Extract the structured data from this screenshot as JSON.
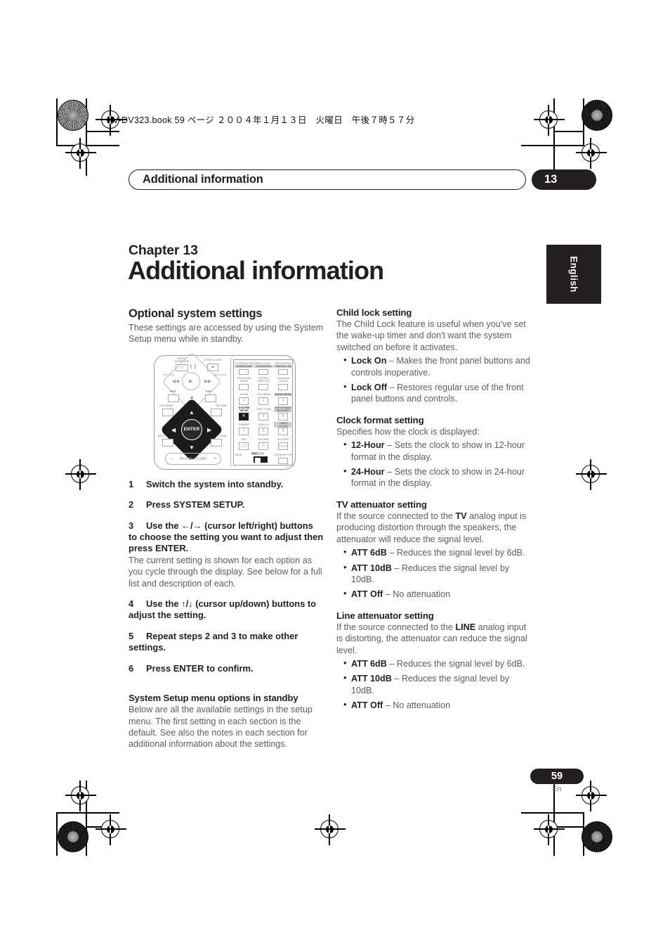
{
  "slug": {
    "text": "XV-DV323.book  59 ページ  ２００４年１月１３日　火曜日　午後７時５７分"
  },
  "running_header": {
    "title": "Additional information",
    "chapter_number": "13"
  },
  "chapter": {
    "label": "Chapter 13",
    "title": "Additional information",
    "language_tab": "English"
  },
  "left_column": {
    "section_title": "Optional system settings",
    "intro": "These settings are accessed by using the System Setup menu while in standby.",
    "remote": {
      "labels": {
        "surround_top": "FRONT",
        "surround": "SURROUND",
        "open_close": "OPEN CLOSE",
        "prev_next_left": "◄◄/◄◄)",
        "prev_next_right": "))►►/►►",
        "dvd_menu": "DVD MENU",
        "return": "RETURN",
        "mute": "MUTE",
        "sound": "SOUND",
        "enter": "ENTER",
        "master_volume": "MASTER VOLUME",
        "minus": "–",
        "plus": "+",
        "col1_top": "LISTENING MODE",
        "col1_top2": "SURROUND",
        "col2_top": "DIALOGUE",
        "col2_top2": "ADVANCED",
        "col3_top": "EXT/STEREO",
        "col3_top2": "VIRTUAL SB",
        "program": "PROGRAM",
        "audio": "AUDIO",
        "repeat": "REPEAT",
        "subtitle": "SUBTITLE",
        "random": "RANDOM",
        "angle": "ANGLE",
        "zoom": "ZOOM",
        "top_menu": "TOP MENU",
        "home_menu": "HOME MENU",
        "system_setup": "SYSTEM SETUP",
        "test_tone": "TEST TONE",
        "setup_navi": "SETUP NAVI/MIDNIGHT",
        "dimmer": "DIMMER",
        "display": "DISPLAY",
        "timer_clock": "TIMER/CLOCK",
        "sr_plus": "SR+",
        "folder_minus": "FOLDER-",
        "folder_plus": "FOLDER+",
        "clr": "CLR",
        "enter_key": "ENTER",
        "main": "MAIN",
        "sub": "SUB",
        "room_setup": "ROOM SETUP",
        "num1": "1",
        "num2": "2",
        "num3": "3",
        "num4": "4",
        "num5": "5",
        "num6": "6",
        "num7": "7",
        "num8": "8",
        "num9": "9",
        "num0": "0"
      }
    },
    "steps": [
      {
        "num": "1",
        "text": "Switch the system into standby.",
        "note": ""
      },
      {
        "num": "2",
        "text": "Press SYSTEM SETUP.",
        "note": ""
      },
      {
        "num": "3",
        "text": "Use the ←/→ (cursor left/right) buttons to choose the setting you want to adjust then press ENTER.",
        "note": "The current setting is shown for each option as you cycle through the display. See below for a full list and description of each."
      },
      {
        "num": "4",
        "text": "Use the ↑/↓ (cursor up/down) buttons to adjust the setting.",
        "note": ""
      },
      {
        "num": "5",
        "text": "Repeat steps 2 and 3 to make other settings.",
        "note": ""
      },
      {
        "num": "6",
        "text": "Press ENTER to confirm.",
        "note": ""
      }
    ],
    "standby_section": {
      "title": "System Setup menu options in standby",
      "body": "Below are all the available settings in the setup menu. The first setting in each section is the default. See also the notes in each section for additional information about the settings."
    }
  },
  "right_column": {
    "sections": [
      {
        "title": "Child lock setting",
        "body": "The Child Lock feature is useful when you've set the wake-up timer and don't want the system switched on before it activates.",
        "body_pre": "",
        "body_bold": "",
        "body_post": "",
        "options": [
          {
            "term": "Lock On",
            "desc": " – Makes the front panel buttons and controls inoperative."
          },
          {
            "term": "Lock Off",
            "desc": " – Restores regular use of the front panel buttons and controls."
          }
        ]
      },
      {
        "title": "Clock format setting",
        "body": "Specifies how the clock is displayed:",
        "body_pre": "",
        "body_bold": "",
        "body_post": "",
        "options": [
          {
            "term": "12-Hour",
            "desc": " – Sets the clock to show in 12-hour format in the display."
          },
          {
            "term": "24-Hour",
            "desc": " – Sets the clock to show in 24-hour format in the display."
          }
        ]
      },
      {
        "title": "TV attenuator setting",
        "body": "",
        "body_pre": "If the source connected to the ",
        "body_bold": "TV",
        "body_post": " analog input is producing distortion through the speakers, the attenuator will reduce the signal level.",
        "options": [
          {
            "term": "ATT 6dB",
            "desc": " – Reduces the signal level by 6dB."
          },
          {
            "term": "ATT 10dB",
            "desc": " – Reduces the signal level by 10dB."
          },
          {
            "term": "ATT Off",
            "desc": " – No attenuation"
          }
        ]
      },
      {
        "title": "Line attenuator setting",
        "body": "",
        "body_pre": "If the source connected to the ",
        "body_bold": "LINE",
        "body_post": " analog input is distorting, the attenuator can reduce the signal level.",
        "options": [
          {
            "term": "ATT 6dB",
            "desc": " – Reduces the signal level by 6dB."
          },
          {
            "term": "ATT 10dB",
            "desc": " – Reduces the signal level by 10dB."
          },
          {
            "term": "ATT Off",
            "desc": " – No attenuation"
          }
        ]
      }
    ]
  },
  "footer": {
    "page_number": "59",
    "language_code": "En"
  }
}
